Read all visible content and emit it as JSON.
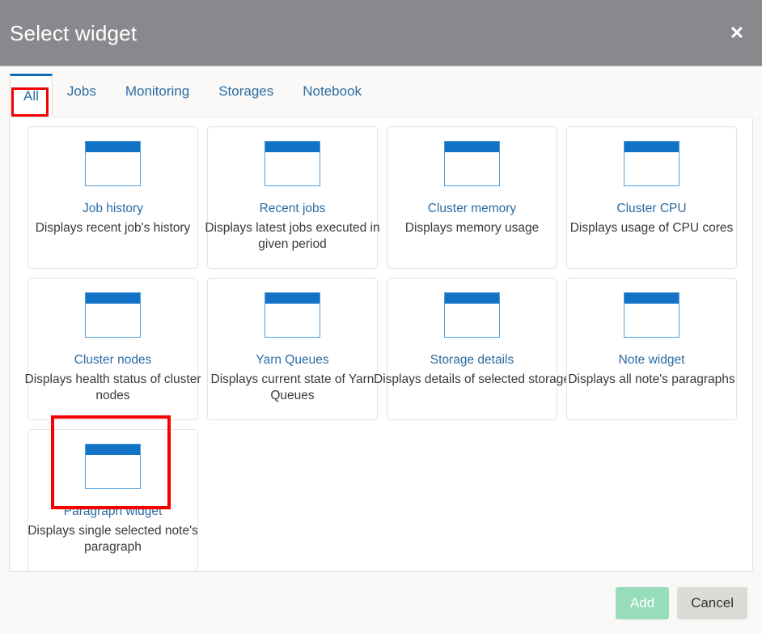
{
  "dialog": {
    "title": "Select widget",
    "close_icon": "close-icon",
    "close_glyph": "✕"
  },
  "tabs": {
    "active_index": 0,
    "items": [
      {
        "label": "All"
      },
      {
        "label": "Jobs"
      },
      {
        "label": "Monitoring"
      },
      {
        "label": "Storages"
      },
      {
        "label": "Notebook"
      }
    ]
  },
  "widgets": [
    {
      "name": "Job history",
      "description": "Displays recent job's history",
      "icon": "window-widget-icon",
      "selected": false
    },
    {
      "name": "Recent jobs",
      "description": "Displays latest jobs executed in given period",
      "icon": "window-widget-icon",
      "selected": false
    },
    {
      "name": "Cluster memory",
      "description": "Displays memory usage",
      "icon": "window-widget-icon",
      "selected": false
    },
    {
      "name": "Cluster CPU",
      "description": "Displays usage of CPU cores",
      "icon": "window-widget-icon",
      "selected": false
    },
    {
      "name": "Cluster nodes",
      "description": "Displays health status of cluster nodes",
      "icon": "window-widget-icon",
      "selected": false
    },
    {
      "name": "Yarn Queues",
      "description": "Displays current state of Yarn Queues",
      "icon": "window-widget-icon",
      "selected": false
    },
    {
      "name": "Storage details",
      "description": "Displays details of selected storage",
      "icon": "window-widget-icon",
      "selected": false
    },
    {
      "name": "Note widget",
      "description": "Displays all note's paragraphs",
      "icon": "window-widget-icon",
      "selected": false
    },
    {
      "name": "Paragraph widget",
      "description": "Displays single selected note's paragraph",
      "icon": "window-widget-icon",
      "selected": true
    }
  ],
  "footer": {
    "add_label": "Add",
    "cancel_label": "Cancel"
  },
  "colors": {
    "header_bg": "#87898c",
    "accent_blue": "#0a6cb8",
    "link_blue": "#2b6ca3",
    "icon_titlebar": "#1273c6",
    "icon_border": "#4e9fdb",
    "highlight_red": "#f50000",
    "add_bg": "#98ddbb",
    "cancel_bg": "#dddbd8",
    "panel_bg": "#ffffff",
    "page_bg": "#f9f8f7"
  }
}
